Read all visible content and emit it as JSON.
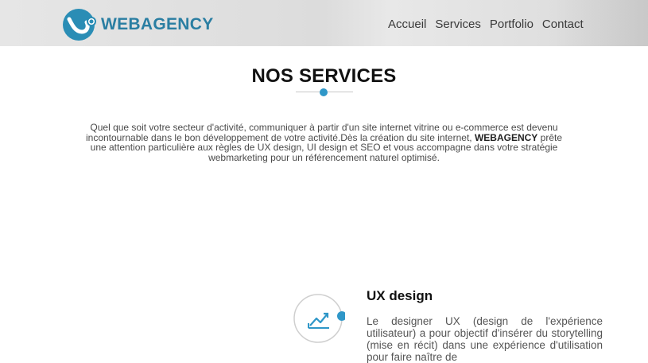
{
  "header": {
    "logo_text": "WEBAGENCY",
    "logo_icon": "webagency-logo-icon",
    "nav": [
      {
        "label": "Accueil"
      },
      {
        "label": "Services"
      },
      {
        "label": "Portfolio"
      },
      {
        "label": "Contact"
      }
    ]
  },
  "services_section": {
    "title": "NOS SERVICES",
    "intro_part1": "Quel que soit votre secteur d'activité, communiquer à partir d'un site internet vitrine ou e-commerce est devenu incontournable dans le bon développement de votre activité.Dès la création du site internet, ",
    "intro_brand": "WEBAGENCY",
    "intro_part2": " prête une attention particulière aux règles de UX design, UI design et SEO et vous accompagne dans votre stratégie webmarketing pour un référencement naturel optimisé.",
    "accent_color": "#2f97c8",
    "items": [
      {
        "icon": "trend-chart-icon",
        "title": "UX design",
        "text": "Le designer UX (design de l'expérience utilisateur) a pour objectif d'insérer du storytelling (mise en récit) dans une expérience d'utilisation pour faire naître de"
      }
    ]
  }
}
